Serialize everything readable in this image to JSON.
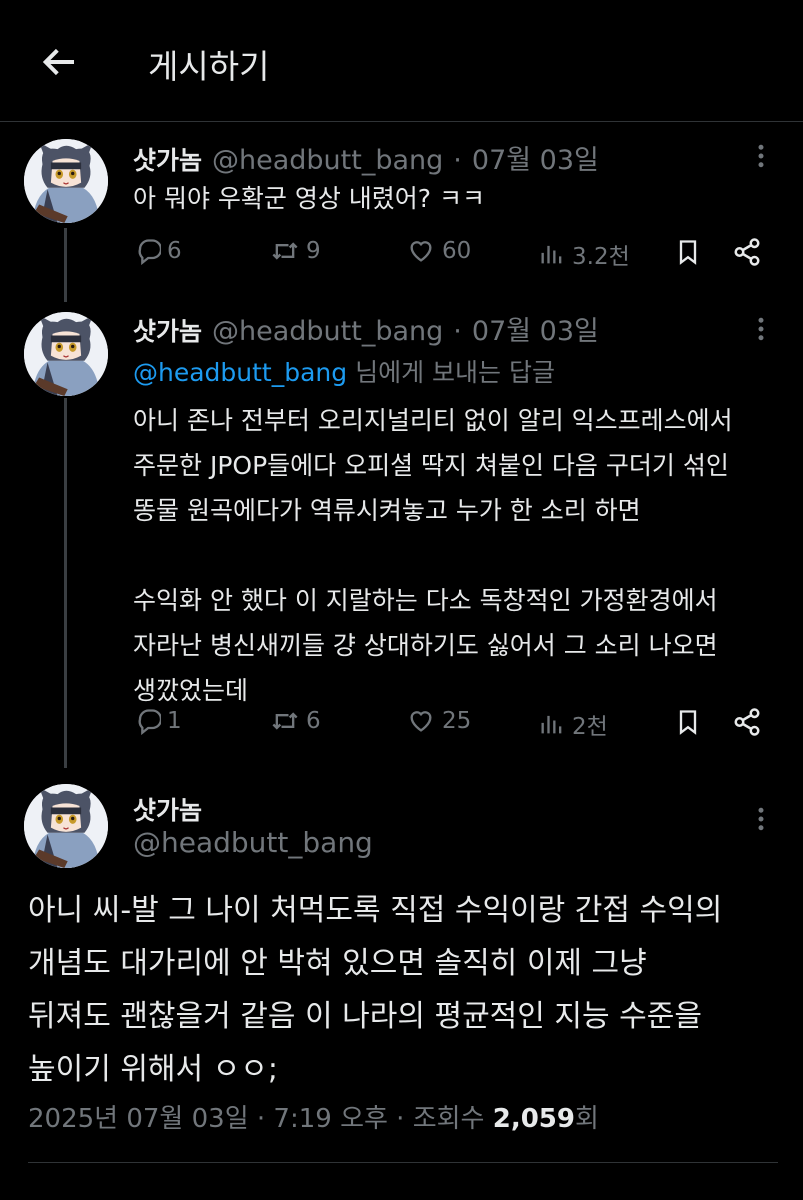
{
  "header": {
    "title": "게시하기"
  },
  "tweets": [
    {
      "name": "샷가놈",
      "handle": "@headbutt_bang",
      "sep": "·",
      "date": "07월 03일",
      "text": "아 뭐야 우확군 영상 내렸어? ㅋㅋ",
      "stats": {
        "replies": "6",
        "retweets": "9",
        "likes": "60",
        "views": "3.2천"
      }
    },
    {
      "name": "샷가놈",
      "handle": "@headbutt_bang",
      "sep": "·",
      "date": "07월 03일",
      "reply_to_mention": "@headbutt_bang",
      "reply_to_suffix": " 님에게 보내는 답글",
      "text": "아니 존나 전부터 오리지널리티 없이 알리 익스프레스에서\n주문한 JPOP들에다 오피셜 딱지 쳐붙인 다음 구더기 섞인\n똥물 원곡에다가 역류시켜놓고 누가 한 소리 하면\n\n수익화 안 했다 이 지랄하는 다소 독창적인 가정환경에서\n자라난 병신새끼들 걍 상대하기도 싫어서 그 소리 나오면\n생깠었는데",
      "stats": {
        "replies": "1",
        "retweets": "6",
        "likes": "25",
        "views": "2천"
      }
    }
  ],
  "main": {
    "name": "샷가놈",
    "handle": "@headbutt_bang",
    "text": "아니 씨-발 그 나이 처먹도록 직접 수익이랑 간접 수익의\n개념도 대가리에 안 박혀 있으면 솔직히 이제 그냥\n뒤져도 괜찮을거 같음 이 나라의 평균적인 지능 수준을\n높이기 위해서 ㅇㅇ;",
    "datetime": "2025년 07월 03일 · 7:19 오후 · 조회수 ",
    "views": "2,059",
    "views_suffix": "회"
  },
  "colors": {
    "background": "#000000",
    "text": "#e7e9ea",
    "muted": "#71767b",
    "accent": "#1d9bf0"
  },
  "icons": [
    "back-arrow-icon",
    "more-icon",
    "reply-icon",
    "retweet-icon",
    "like-icon",
    "views-icon",
    "bookmark-icon",
    "share-icon"
  ]
}
